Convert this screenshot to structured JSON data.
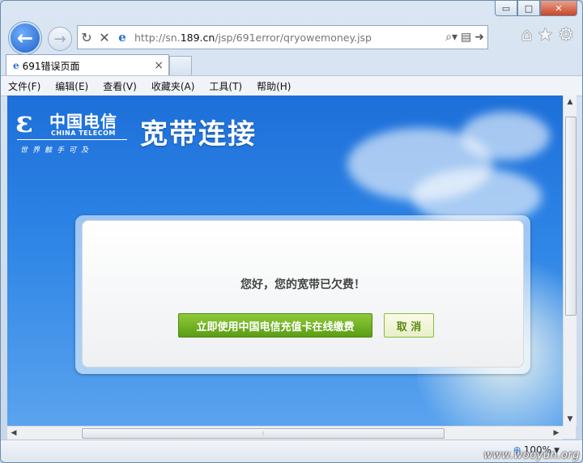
{
  "browser": {
    "window_buttons": {
      "minimize": "▭",
      "maximize": "□",
      "close": "✕"
    },
    "address": {
      "url_prefix": "http://sn.",
      "url_domain": "189.cn",
      "url_suffix": "/jsp/691error/qryowemoney.jsp"
    },
    "tab": {
      "title": "691错误页面",
      "close": "×"
    },
    "menu": [
      "文件(F)",
      "编辑(E)",
      "查看(V)",
      "收藏夹(A)",
      "工具(T)",
      "帮助(H)"
    ],
    "zoom": "100%"
  },
  "page": {
    "logo_cn": "中国电信",
    "logo_en": "CHINA TELECOM",
    "logo_slogan": "世界触手可及",
    "headline": "宽带连接",
    "dialog": {
      "message": "您好，您的宽带已欠费！",
      "pay_button": "立即使用中国电信充值卡在线缴费",
      "cancel_button": "取 消"
    }
  },
  "watermark": "www.wooyun.org",
  "icons": {
    "back": "back-arrow-icon",
    "forward": "forward-arrow-icon",
    "refresh": "refresh-icon",
    "stop": "stop-icon",
    "ie": "ie-logo-icon",
    "search": "search-icon",
    "compat": "compatibility-view-icon",
    "go": "go-arrow-icon",
    "home": "home-icon",
    "favorites": "favorites-star-icon",
    "tools": "gear-icon"
  }
}
